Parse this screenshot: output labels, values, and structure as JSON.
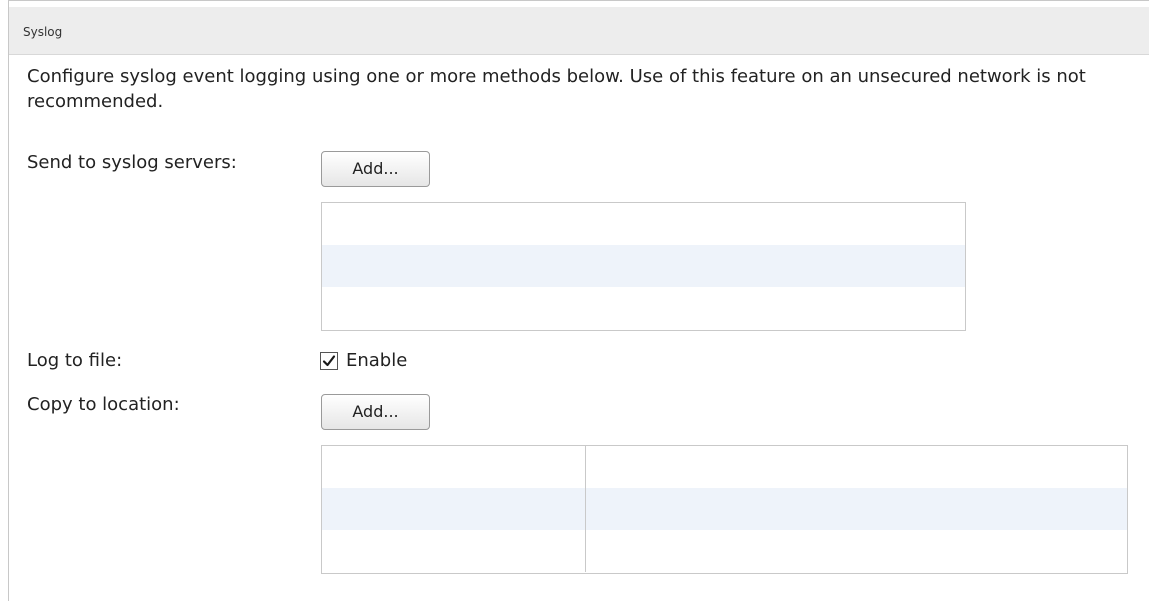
{
  "panel": {
    "title": "Syslog",
    "description": "Configure syslog event logging using one or more methods below. Use of this feature on an unsecured network is not recommended."
  },
  "syslog_servers": {
    "label": "Send to syslog servers:",
    "add_button": "Add..."
  },
  "log_to_file": {
    "label": "Log to file:",
    "checkbox_label": "Enable",
    "checked": true
  },
  "copy_to_location": {
    "label": "Copy to location:",
    "add_button": "Add..."
  },
  "colors": {
    "header_bg": "#ededed",
    "alt_row": "#eef3fa",
    "border": "#c9c9c9"
  },
  "icons": {
    "checkbox": "checkmark-icon"
  }
}
